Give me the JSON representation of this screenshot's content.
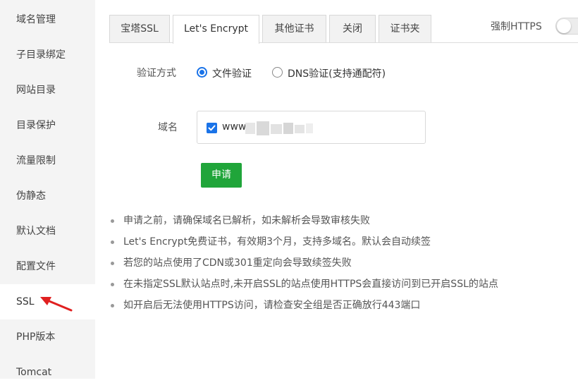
{
  "sidebar": {
    "items": [
      {
        "label": "域名管理"
      },
      {
        "label": "子目录绑定"
      },
      {
        "label": "网站目录"
      },
      {
        "label": "目录保护"
      },
      {
        "label": "流量限制"
      },
      {
        "label": "伪静态"
      },
      {
        "label": "默认文档"
      },
      {
        "label": "配置文件"
      },
      {
        "label": "SSL"
      },
      {
        "label": "PHP版本"
      },
      {
        "label": "Tomcat"
      }
    ],
    "active": "SSL"
  },
  "tabs": [
    {
      "label": "宝塔SSL"
    },
    {
      "label": "Let's Encrypt"
    },
    {
      "label": "其他证书"
    },
    {
      "label": "关闭"
    },
    {
      "label": "证书夹"
    }
  ],
  "active_tab": "Let's Encrypt",
  "force_https": {
    "label": "强制HTTPS",
    "enabled": false
  },
  "verify": {
    "label": "验证方式",
    "options": [
      {
        "label": "文件验证",
        "checked": true
      },
      {
        "label": "DNS验证(支持通配符)",
        "checked": false
      }
    ]
  },
  "domain": {
    "label": "域名",
    "items": [
      {
        "text": "www",
        "checked": true
      }
    ]
  },
  "apply_button": "申请",
  "tips": [
    "申请之前，请确保域名已解析，如未解析会导致审核失败",
    "Let's Encrypt免费证书，有效期3个月，支持多域名。默认会自动续签",
    "若您的站点使用了CDN或301重定向会导致续签失败",
    "在未指定SSL默认站点时,未开启SSL的站点使用HTTPS会直接访问到已开启SSL的站点",
    "如开启后无法使用HTTPS访问，请检查安全组是否正确放行443端口"
  ],
  "colors": {
    "accent_green": "#20a53a",
    "accent_blue": "#1a73e8",
    "arrow_red": "#e02020"
  }
}
